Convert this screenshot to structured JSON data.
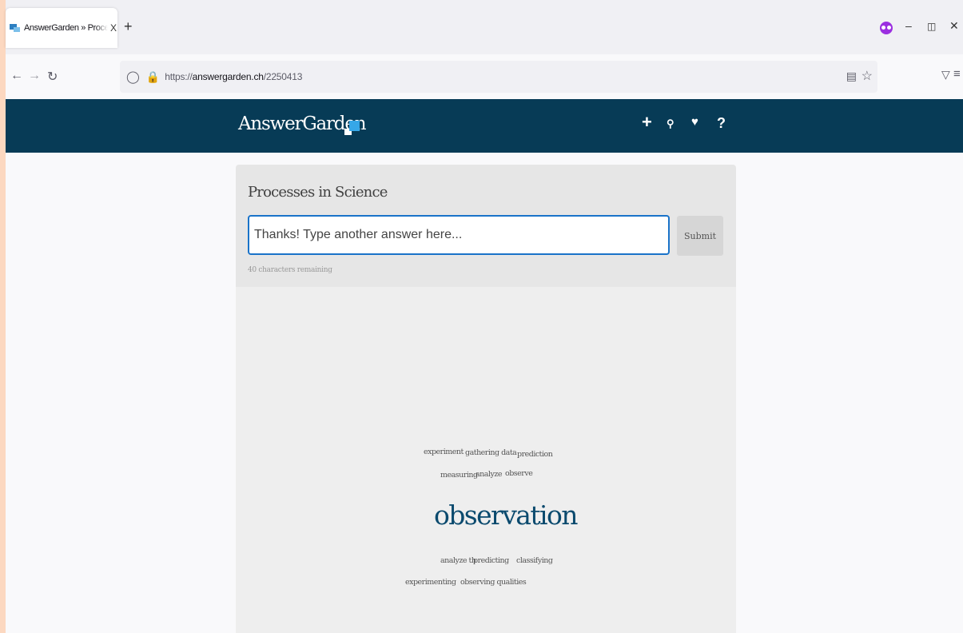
{
  "browser": {
    "tab_title": "AnswerGarden » Processes in Science",
    "tab_close": "X",
    "new_tab": "+",
    "url_prefix": "https://",
    "url_domain": "answergarden.ch",
    "url_path": "/2250413"
  },
  "site": {
    "logo_text": "AnswerGarden",
    "header_icons": [
      "plus-icon",
      "search-icon",
      "heart-icon",
      "help-icon"
    ],
    "accent_color": "#073b56"
  },
  "question": {
    "title": "Processes in Science",
    "input_placeholder": "Thanks! Type another answer here...",
    "submit_label": "Submit",
    "chars_remaining": "40 characters remaining"
  },
  "answers": {
    "words": [
      "experiment",
      "gathering data",
      "prediction",
      "measuring",
      "analyze",
      "observe",
      "observation",
      "analyze th",
      "predicting",
      "classifying",
      "experimenting",
      "observing qualities"
    ]
  }
}
